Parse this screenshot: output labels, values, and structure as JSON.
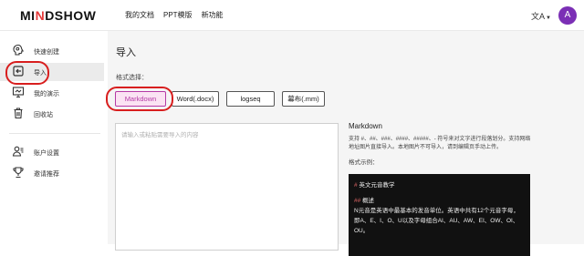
{
  "header": {
    "logo_pre": "MI",
    "logo_dot": "N",
    "logo_post": "DSHOW",
    "nav": [
      "我的文档",
      "PPT模版",
      "新功能"
    ],
    "lang_icon": "文A",
    "avatar_letter": "A"
  },
  "sidebar": {
    "items": [
      {
        "label": "快速创建",
        "icon": "brain-icon"
      },
      {
        "label": "导入",
        "icon": "import-icon"
      },
      {
        "label": "我的演示",
        "icon": "presentation-icon"
      },
      {
        "label": "回收站",
        "icon": "trash-icon"
      },
      {
        "label": "账户设置",
        "icon": "account-icon"
      },
      {
        "label": "邀请推荐",
        "icon": "trophy-icon"
      }
    ]
  },
  "main": {
    "title": "导入",
    "format_label": "格式选择：",
    "formats": [
      "Markdown",
      "Word(.docx)",
      "logseq",
      "幕布(.mm)"
    ],
    "selected_format": "Markdown",
    "textarea_placeholder": "请输入或粘贴需要导入的内容",
    "help": {
      "title": "Markdown",
      "description": "支持 #、##、###、####、#####、- 符号来对文字进行段落划分。支持网络地址图片直接导入。本地图片不可导入，请到编辑页手动上传。",
      "example_label": "格式示例：",
      "code_lines": [
        {
          "mark": "#",
          "text": "英文元音教学"
        },
        {
          "mark": "##",
          "text": "概述"
        },
        {
          "mark": "",
          "text": "N元音是英语中最基本的发音单位。英语中共有12个元音字母，"
        },
        {
          "mark": "",
          "text": "即A、E、I、O、U以及字母组合AI、AU、AW、EI、OW、OI、"
        },
        {
          "mark": "",
          "text": "OU。"
        }
      ]
    }
  },
  "colors": {
    "accent": "#b53aa6",
    "avatar": "#7b2fb5",
    "highlight_ring": "#d81e1e"
  }
}
